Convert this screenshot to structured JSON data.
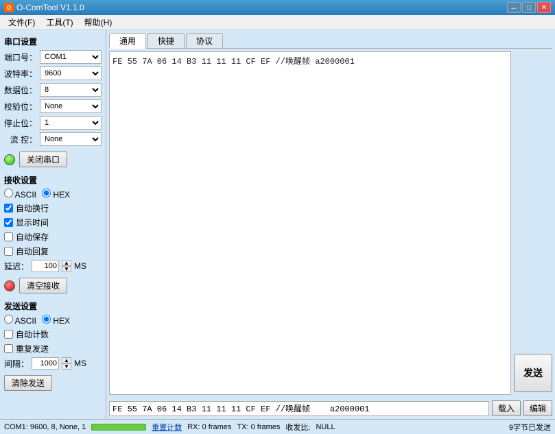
{
  "titleBar": {
    "title": "O-ComTool V1.1.0",
    "iconLabel": "O",
    "minBtn": "－",
    "maxBtn": "□",
    "closeBtn": "✕"
  },
  "menuBar": {
    "items": [
      {
        "label": "文件(F)"
      },
      {
        "label": "工具(T)"
      },
      {
        "label": "帮助(H)"
      }
    ]
  },
  "leftPanel": {
    "serialSettings": {
      "title": "串口设置",
      "portLabel": "端口号：",
      "portValue": "COM1",
      "baudLabel": "波特率：",
      "baudValue": "9600",
      "dataBitsLabel": "数据位：",
      "dataBitsValue": "8",
      "parityLabel": "校验位：",
      "parityValue": "None",
      "stopBitsLabel": "停止位：",
      "stopBitsValue": "1",
      "flowLabel": "流  控：",
      "flowValue": "None",
      "closePortBtn": "关闭串口"
    },
    "receiveSettings": {
      "title": "接收设置",
      "asciiLabel": "ASCII",
      "hexLabel": "HEX",
      "autoNewline": "自动换行",
      "showTime": "显示时间",
      "autoSave": "自动保存",
      "autoReply": "自动回复",
      "delayLabel": "延迟：",
      "delayValue": "100",
      "delayUnit": "MS",
      "clearBtn": "清空接收"
    },
    "sendSettings": {
      "title": "发送设置",
      "asciiLabel": "ASCII",
      "hexLabel": "HEX",
      "autoCount": "自动计数",
      "repeatSend": "重复发送",
      "intervalLabel": "间隔：",
      "intervalValue": "1000",
      "intervalUnit": "MS",
      "clearBtn": "清除发送"
    }
  },
  "rightPanel": {
    "tabs": [
      {
        "label": "通用",
        "active": true
      },
      {
        "label": "快捷"
      },
      {
        "label": "协议"
      }
    ],
    "receiveContent": "FE 55 7A 06 14 B3 11 11 11 CF EF //唤醒帧    a2000001",
    "sendInputValue": "FE 55 7A 06 14 B3 11 11 11 CF EF //唤醒帧    a2000001",
    "sendBtn": "发送",
    "loadBtn": "载入",
    "editBtn": "编辑"
  },
  "statusBar": {
    "portInfo": "COM1: 9600, 8, None, 1",
    "resetLabel": "重置计数",
    "rxInfo": "RX: 0 frames",
    "txInfo": "TX: 0 frames",
    "recvRateLabel": "收发比:",
    "recvRateValue": "NULL",
    "bytesInfo": "9字节已发送"
  }
}
